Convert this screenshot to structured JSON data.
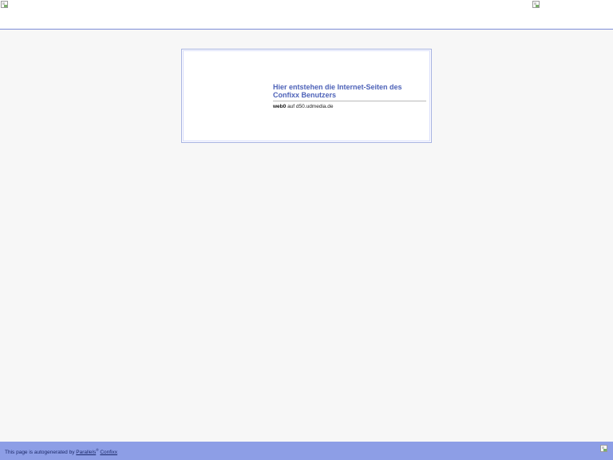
{
  "header": {
    "logo_left_icon": "broken-image-icon",
    "logo_right_icon": "broken-image-icon"
  },
  "card": {
    "title": "Hier entstehen die Internet-Seiten des Confixx Benutzers",
    "user": "web0",
    "connector": " auf ",
    "host": "d50.udmedia.de"
  },
  "footer": {
    "prefix": "This page is autogenerated by ",
    "vendor_link": "Parallels",
    "registered_mark": "®",
    "product_link": "Confixx",
    "logo_icon": "broken-image-icon"
  },
  "colors": {
    "accent": "#4d62b8",
    "footer_bg": "#8d9ee6",
    "page_bg": "#f7f7f7",
    "card_border": "#a8b4e2"
  }
}
